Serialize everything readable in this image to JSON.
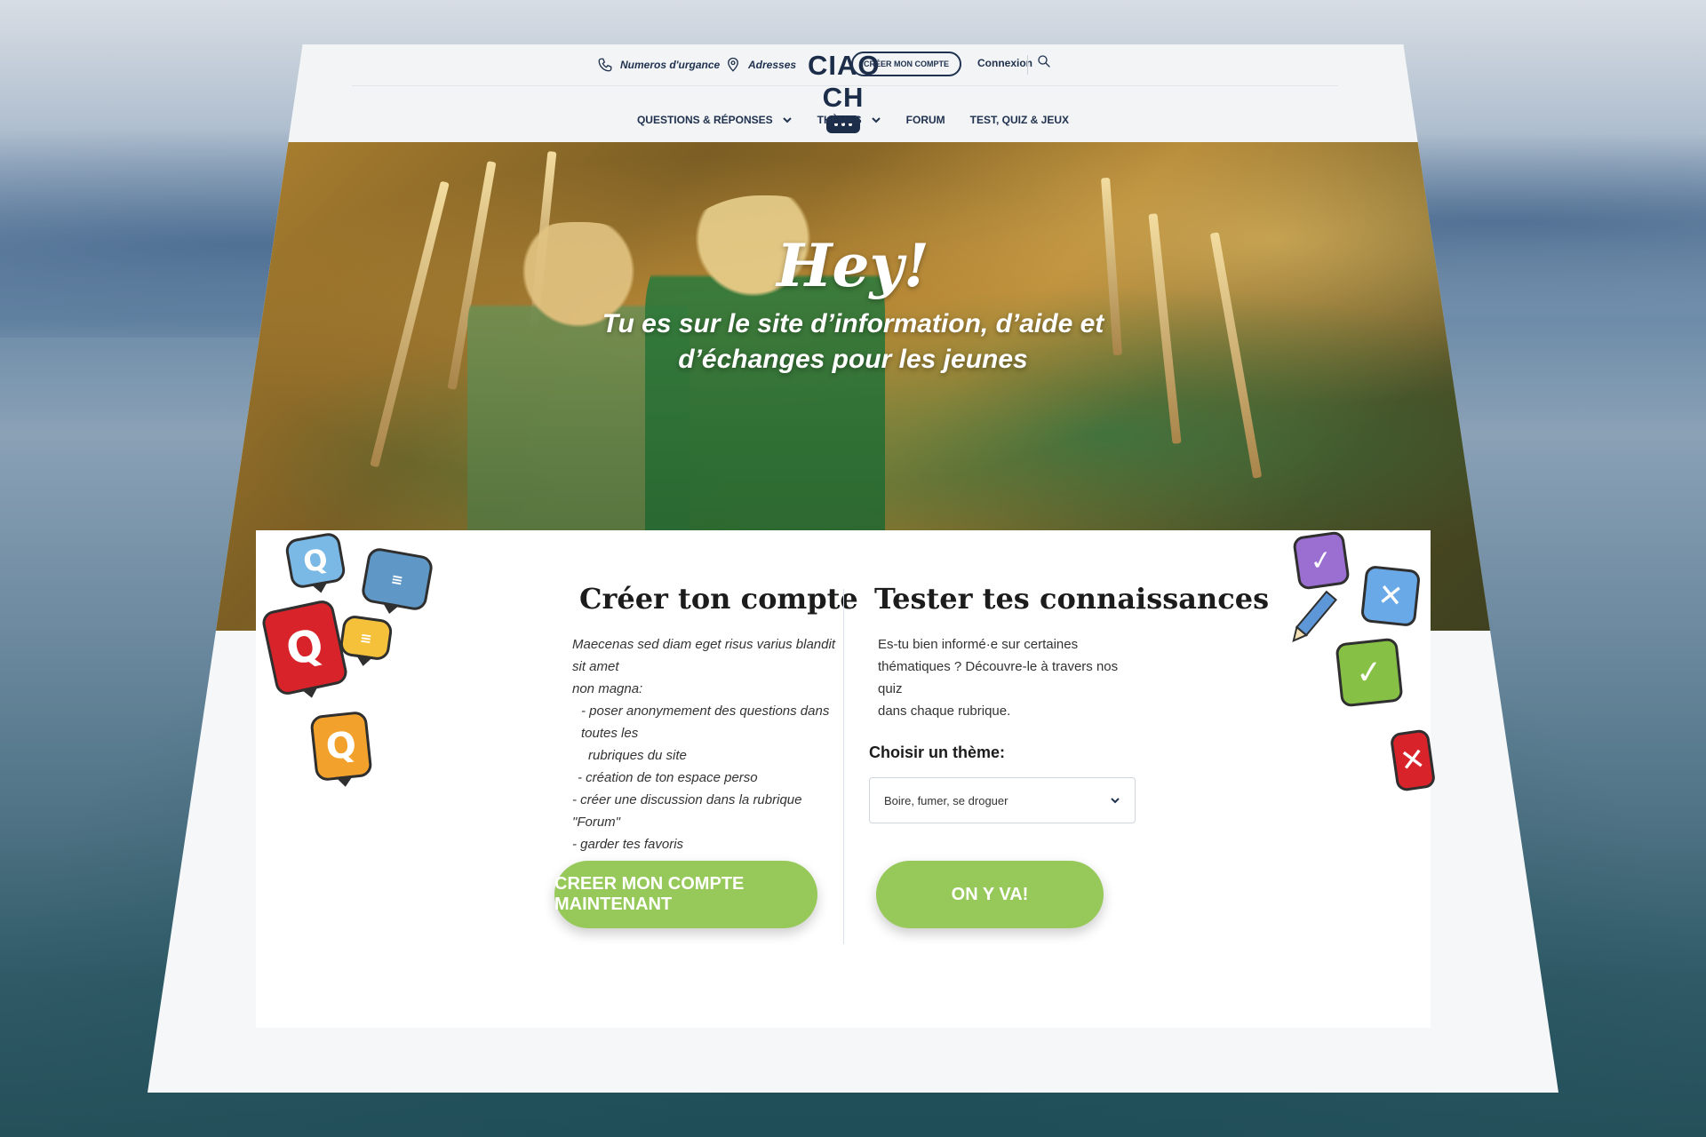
{
  "header": {
    "utility_links": [
      {
        "label": "Numeros d'urgance",
        "icon": "phone-icon"
      },
      {
        "label": "Adresses",
        "icon": "location-pin-icon"
      }
    ],
    "logo_text": "CIAO CH",
    "create_account_label": "CRÉER MON COMPTE",
    "login_label": "Connexion",
    "search_icon": "search-icon"
  },
  "nav": {
    "items": [
      {
        "label": "QUESTIONS & RÉPONSES",
        "has_dropdown": true
      },
      {
        "label": "THÈMES",
        "has_dropdown": true
      },
      {
        "label": "FORUM",
        "has_dropdown": false
      },
      {
        "label": "TEST, QUIZ & JEUX",
        "has_dropdown": false
      }
    ]
  },
  "hero": {
    "greeting": "Hey!",
    "subtitle_line1": "Tu es sur le site d’information, d’aide et",
    "subtitle_line2": "d’échanges pour les jeunes"
  },
  "account_card": {
    "title": "Créer ton compte",
    "intro_line1": "Maecenas sed diam eget risus varius blandit sit amet",
    "intro_line2": "non magna:",
    "bullets": [
      "- poser anonymement des questions dans toutes les",
      "rubriques du site",
      "- création de ton espace perso",
      "- créer une discussion dans la rubrique \"Forum\"",
      "- garder tes favoris"
    ],
    "button_label": "CREER MON COMPTE MAINTENANT"
  },
  "quiz_card": {
    "title": "Tester tes connaissances",
    "text_line1": "Es-tu bien informé·e sur certaines",
    "text_line2": "thématiques ? Découvre-le à travers nos quiz",
    "text_line3": "dans chaque rubrique.",
    "theme_label": "Choisir un thème:",
    "theme_selected": "Boire, fumer, se droguer",
    "button_label": "ON Y VA!"
  },
  "colors": {
    "navy": "#1c2d4a",
    "green_button": "#97c95a",
    "page_bg": "#f5f7f9"
  }
}
